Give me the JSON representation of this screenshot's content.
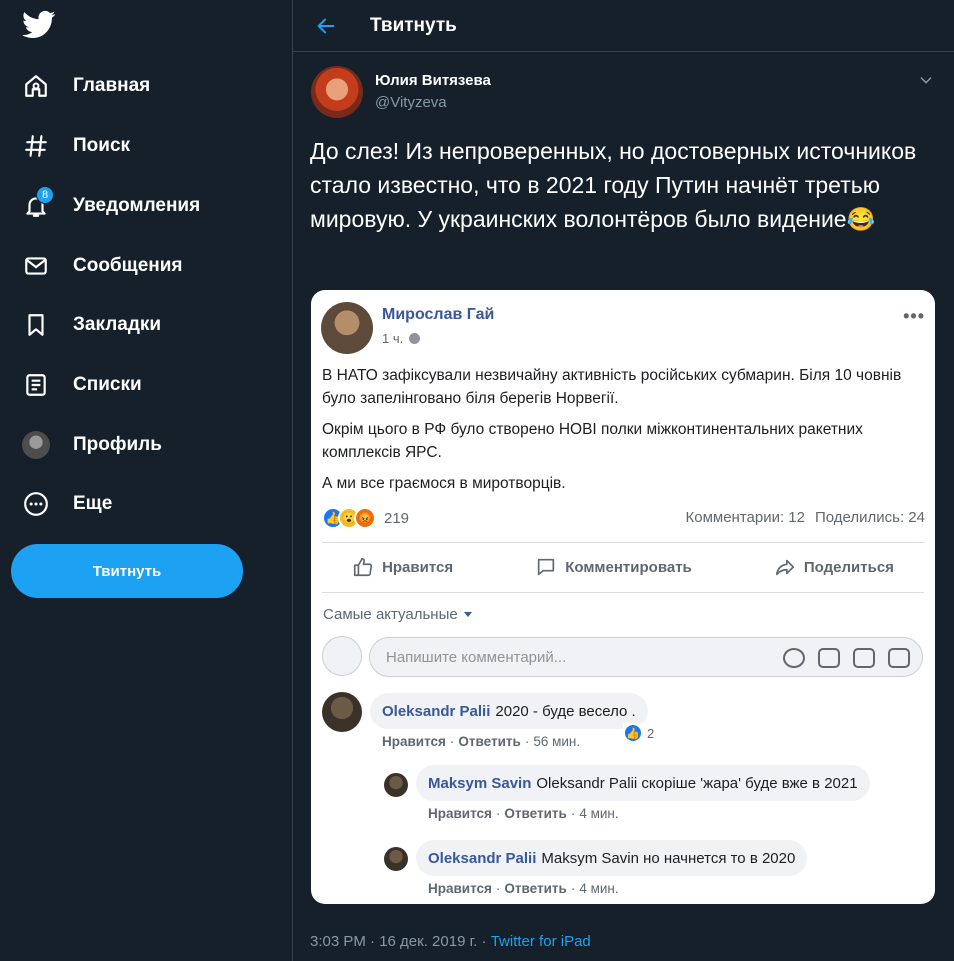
{
  "sidebar": {
    "logo": "twitter-bird-icon",
    "items": [
      {
        "label": "Главная",
        "icon": "home-icon"
      },
      {
        "label": "Поиск",
        "icon": "hashtag-icon"
      },
      {
        "label": "Уведомления",
        "icon": "bell-icon",
        "badge": "8"
      },
      {
        "label": "Сообщения",
        "icon": "mail-icon"
      },
      {
        "label": "Закладки",
        "icon": "bookmark-icon"
      },
      {
        "label": "Списки",
        "icon": "list-icon"
      },
      {
        "label": "Профиль",
        "icon": "avatar"
      },
      {
        "label": "Еще",
        "icon": "more-icon"
      }
    ],
    "tweet_button": "Твитнуть"
  },
  "header": {
    "title": "Твитнуть"
  },
  "tweet": {
    "author_name": "Юлия Витязева",
    "author_handle": "@Vityzeva",
    "text": "До слез! Из непроверенных, но достоверных источников стало известно, что в 2021 году Путин начнёт третью мировую. У украинских волонтёров было видение😂",
    "timestamp": "3:03 PM · 16 дек. 2019 г. · ",
    "source": "Twitter for iPad"
  },
  "fb_post": {
    "author": "Мирослав Гай",
    "time": "1 ч.",
    "paragraphs": [
      "В НАТО зафіксували незвичайну активність російських субмарин. Біля 10 човнів було запелінговано біля берегів Норвегії.",
      "Окрім цього в РФ було створено НОВІ полки міжконтинентальних ракетних комплексів ЯРС.",
      "А ми все граємося в миротворців."
    ],
    "reaction_count": "219",
    "comments_stat": "Комментарии: 12",
    "shares_stat": "Поделились: 24",
    "actions": {
      "like": "Нравится",
      "comment": "Комментировать",
      "share": "Поделиться"
    },
    "sort_label": "Самые актуальные",
    "comment_placeholder": "Напишите комментарий...",
    "comments": [
      {
        "author": "Oleksandr Palii",
        "text": "2020 - буде весело .",
        "like": "Нравится",
        "reply": "Ответить",
        "time": "56 мин.",
        "reactions": "2"
      },
      {
        "author": "Maksym Savin",
        "text": "Oleksandr Palii скоріше 'жара' буде вже в 2021",
        "like": "Нравится",
        "reply": "Ответить",
        "time": "4 мин."
      },
      {
        "author": "Oleksandr Palii",
        "text": "Maksym Savin но начнется то в 2020",
        "like": "Нравится",
        "reply": "Ответить",
        "time": "4 мин."
      }
    ]
  },
  "colors": {
    "background": "#15202b",
    "accent": "#1da1f2",
    "fb_link": "#385898"
  }
}
